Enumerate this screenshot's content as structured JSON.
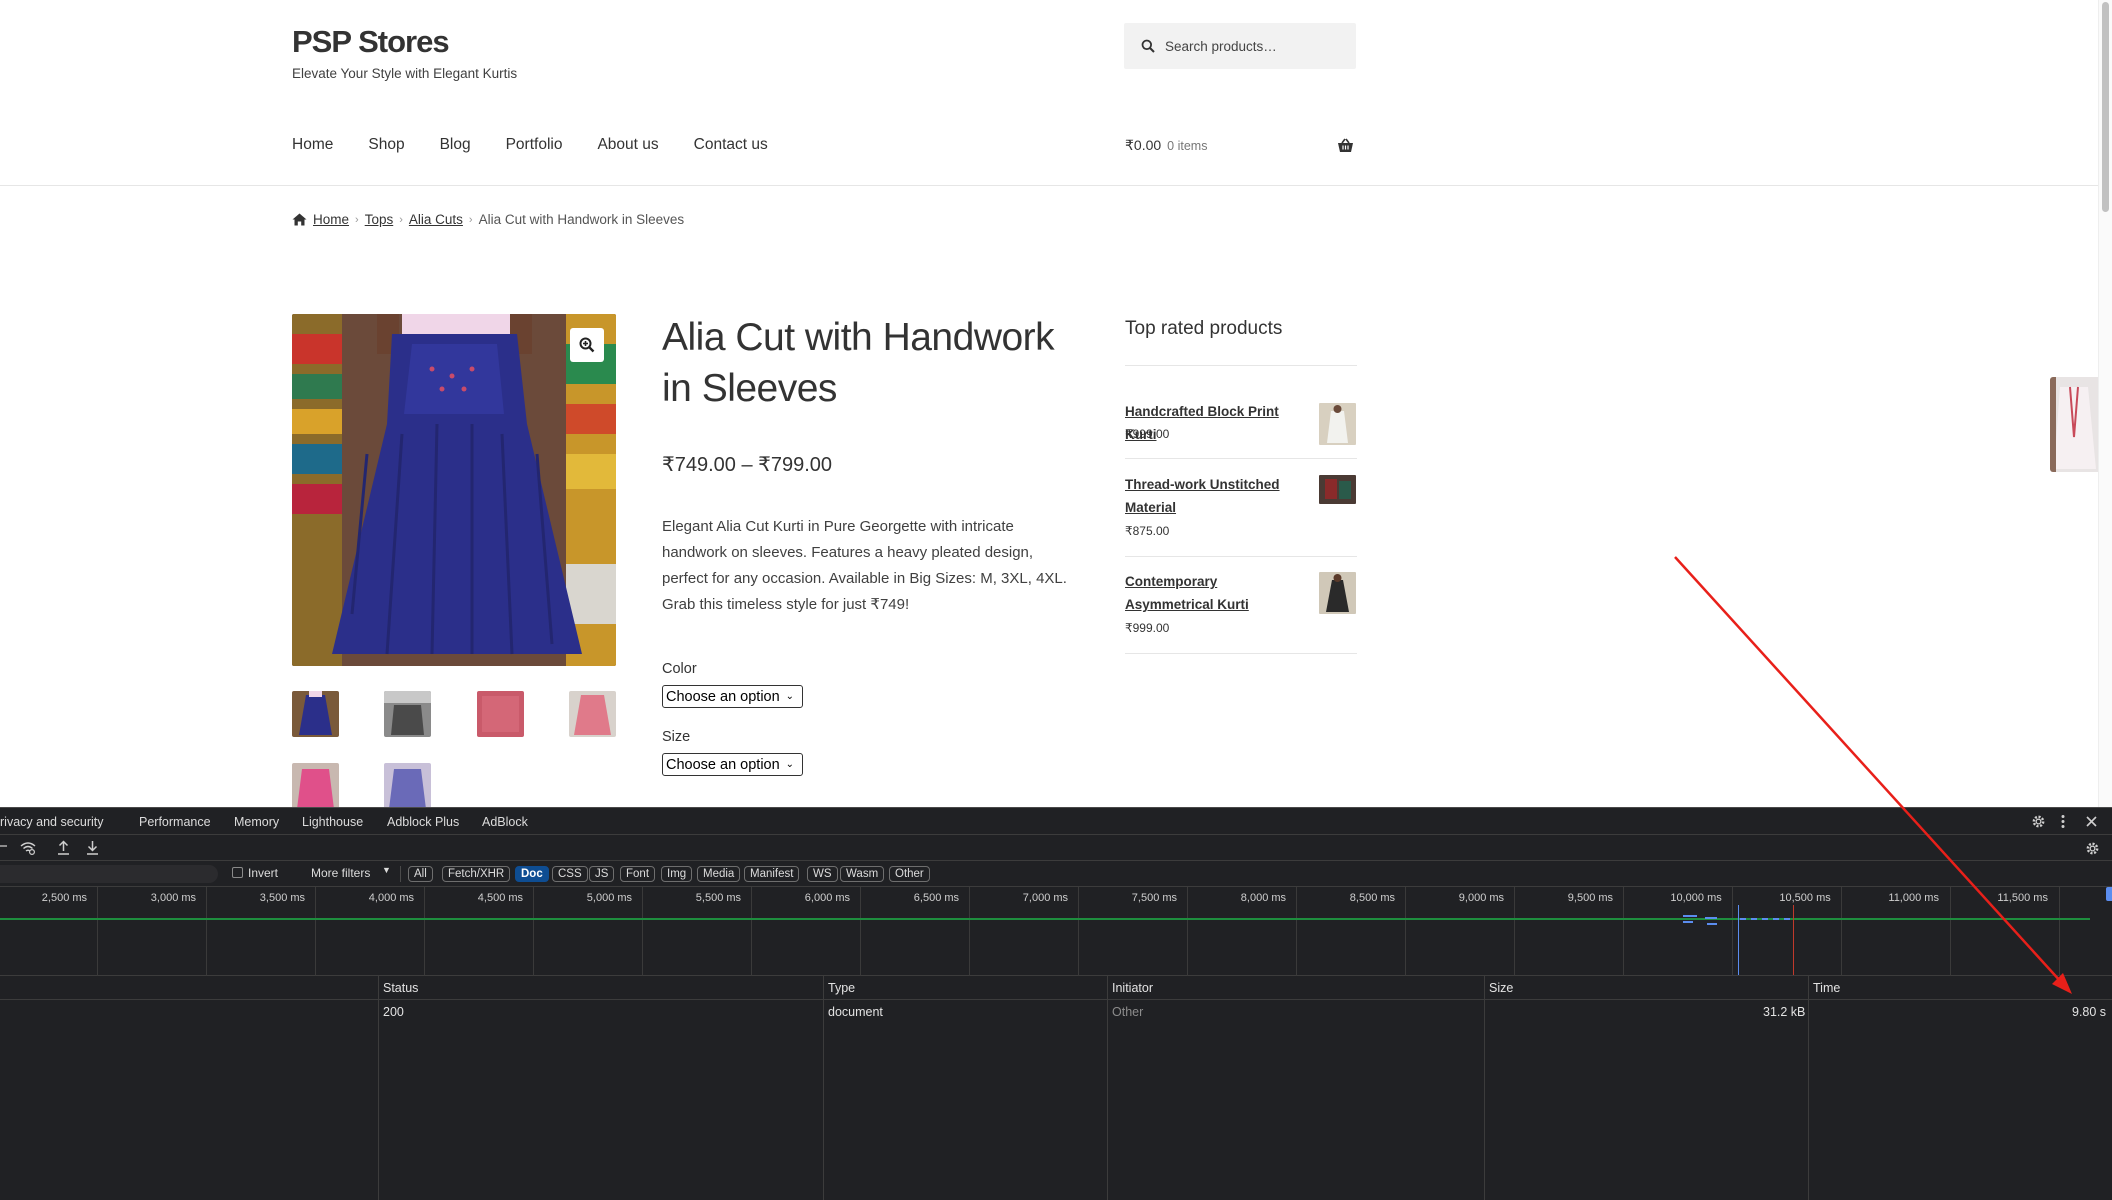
{
  "site": {
    "title": "PSP Stores",
    "tagline": "Elevate Your Style with Elegant Kurtis",
    "search_placeholder": "Search products…",
    "nav": [
      "Home",
      "Shop",
      "Blog",
      "Portfolio",
      "About us",
      "Contact us"
    ],
    "cart": {
      "amount": "₹0.00",
      "items": "0 items"
    },
    "breadcrumb": [
      "Home",
      "Tops",
      "Alia Cuts",
      "Alia Cut with Handwork in Sleeves"
    ],
    "product": {
      "title": "Alia Cut with Handwork in Sleeves",
      "price": "₹749.00 – ₹799.00",
      "description": "Elegant Alia Cut Kurti in Pure Georgette with intricate handwork on sleeves. Features a heavy pleated design, perfect for any occasion. Available in Big Sizes: M, 3XL, 4XL. Grab this timeless style for just ₹749!",
      "color_label": "Color",
      "color_value": "Choose an option",
      "size_label": "Size",
      "size_value": "Choose an option"
    },
    "top_rated": {
      "title": "Top rated products",
      "items": [
        {
          "name": "Handcrafted Block Print Kurti",
          "price": "₹999.00"
        },
        {
          "name": "Thread-work Unstitched Material",
          "price": "₹875.00"
        },
        {
          "name": "Contemporary Asymmetrical Kurti",
          "price": "₹999.00"
        }
      ]
    }
  },
  "devtools": {
    "tabs": [
      "rivacy and security",
      "Performance",
      "Memory",
      "Lighthouse",
      "Adblock Plus",
      "AdBlock"
    ],
    "invert_label": "Invert",
    "more_filters": "More filters",
    "filter_chips": [
      "All",
      "Fetch/XHR",
      "Doc",
      "CSS",
      "JS",
      "Font",
      "Img",
      "Media",
      "Manifest",
      "WS",
      "Wasm",
      "Other"
    ],
    "active_chip": "Doc",
    "timeline_ticks": [
      "2,500 ms",
      "3,000 ms",
      "3,500 ms",
      "4,000 ms",
      "4,500 ms",
      "5,000 ms",
      "5,500 ms",
      "6,000 ms",
      "6,500 ms",
      "7,000 ms",
      "7,500 ms",
      "8,000 ms",
      "8,500 ms",
      "9,000 ms",
      "9,500 ms",
      "10,000 ms",
      "10,500 ms",
      "11,000 ms",
      "11,500 ms"
    ],
    "columns": [
      "Status",
      "Type",
      "Initiator",
      "Size",
      "Time"
    ],
    "row": {
      "status": "200",
      "type": "document",
      "initiator": "Other",
      "size": "31.2 kB",
      "time": "9.80 s"
    }
  },
  "colors": {
    "annotation_arrow": "#e8201a",
    "devtools_bg": "#202124",
    "active_chip": "#0e4d92"
  }
}
